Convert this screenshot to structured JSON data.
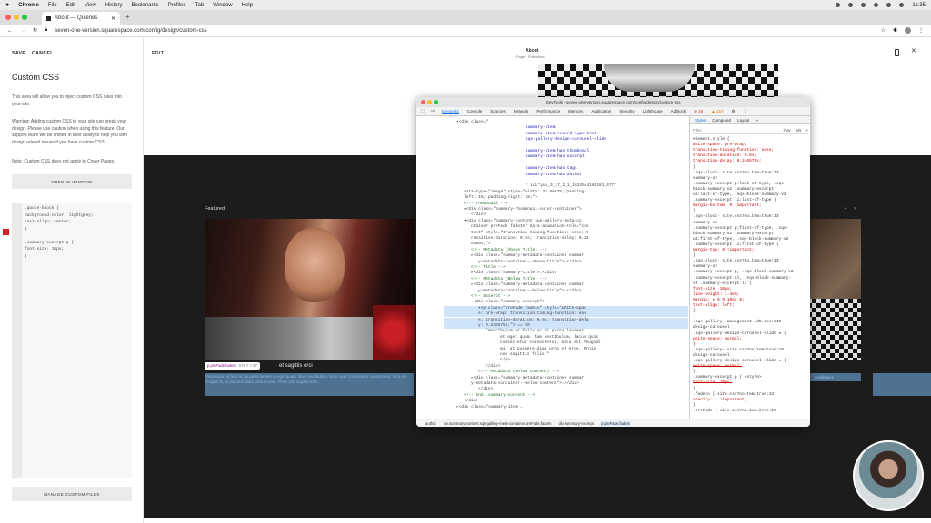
{
  "menubar": {
    "app": "Chrome",
    "items": [
      "File",
      "Edit",
      "View",
      "History",
      "Bookmarks",
      "Profiles",
      "Tab",
      "Window",
      "Help"
    ],
    "clock": "11:35"
  },
  "browser": {
    "tab_title": "About — Quienes",
    "url": "seven-one-version.squarespace.com/config/design/custom-css"
  },
  "left_panel": {
    "save": "SAVE",
    "cancel": "CANCEL",
    "title": "Custom CSS",
    "intro": "This area will allow you to inject custom CSS rules into your site.",
    "warning": "Warning: Adding custom CSS to your site can break your design. Please use caution when using this feature. Our support team will be limited in their ability to help you with design related issues if you have custom CSS.",
    "note": "Note: Custom CSS does not apply to Cover Pages.",
    "open_window": "OPEN IN WINDOW",
    "manage_files": "MANAGE CUSTOM FILES",
    "code": [
      ".quote-block {",
      "  background-color: lightgrey;",
      "  text-align: center;",
      "}",
      "",
      ".summary-excerpt p {",
      "  font-size: 10px;",
      "}"
    ]
  },
  "preview": {
    "edit": "EDIT",
    "page_title": "About",
    "page_status": "Page · Published",
    "featured": "Featured",
    "element_tag": "p.preFade.fadeIn",
    "element_size": "578.7 × 57",
    "caption_heading": "et sagittis orci",
    "excerpt": "Vestibulum ut felis ac mi porta laoreet et eget quam. Nam vestibulum, lacus quis consectetur consectetur, arcu est feugiat mi, at posuere diam urna et eros. Proin non sagittis felis.",
    "right_caption": "vestibulum"
  },
  "devtools": {
    "title": "DevTools - seven-one-version.squarespace.com/config/design/custom-css",
    "tabs": [
      "Elements",
      "Console",
      "Sources",
      "Network",
      "Performance",
      "Memory",
      "Application",
      "Security",
      "Lighthouse",
      "AdBlock"
    ],
    "errors": "25",
    "warnings": "157",
    "style_tabs": [
      "Styles",
      "Computed",
      "Layout",
      "»"
    ],
    "filter": "Filter",
    "filter_tags": [
      ":hov",
      ".cls",
      "+"
    ],
    "dom_lines": [
      "▾<div class=\"",
      "summary-item",
      "summary-item-record-type-text",
      "sqs-gallery-design-carousel-slide",
      "",
      "summary-item-has-thumbnail",
      "summary-item-has-excerpt",
      "",
      "summary-item-has-tags",
      "summary-item-has-author",
      "",
      "\" id=\"yui_3_17_2_1_1624544189181_477\"",
      "data-type=\"image\" style=\"width: 33.6667%; padding-",
      "left: 1%; padding-right: 1%;\">",
      "<!-- Thumbnail -->",
      "▸<div class=\"summary-thumbnail-outer-container\">",
      "</div>",
      "▾<div class=\"summary-content sqs-gallery-meta-co",
      "ntainer preFade fadeIn\" data-animation-role=\"con",
      "tent\" style=\"transition-timing-function: ease; t",
      "ransition-duration: 0.6s; transition-delay: 0.23",
      "8366s;\">",
      "<!-- Metadata (Above Title) -->",
      "▸<div class=\"summary-metadata-container summar",
      "y-metadata-container--above-title\">…</div>",
      "<!-- Title -->",
      "▸<div class=\"summary-title\">…</div>",
      "<!-- Metadata (Below Title) -->",
      "▸<div class=\"summary-metadata-container summar",
      "y-metadata-container--below-title\">…</div>",
      "<!-- Excerpt -->",
      "▾<div class=\"summary-excerpt\">",
      "▾<p class=\"preFade fadeIn\" style=\"white-spac",
      "e: pre-wrap; transition-timing-function: eas",
      "e; transition-duration: 0.6s; transition-dela",
      "y: 0.246575s;\"> == $0",
      "\"Vestibulum ut felis ac mi porta laoreet",
      "et eget quam. Nam vestibulum, lacus quis",
      "consectetur consectetur, arcu est feugiat",
      "mi, at posuere diam urna et eros. Proin",
      "non sagittis felis.\"",
      "</p>",
      "</div>",
      "<!-- Metadata (Below Content) -->",
      "▸<div class=\"summary-metadata-container summar",
      "y-metadata-container--below-content\">…</div>",
      "</div>",
      "<!-- End .summary-content -->",
      "</div>",
      "▸<div class=\"summary-item …"
    ],
    "style_lines": [
      "element.style {",
      "  white-space: pre-wrap;",
      "  transition-timing-function: ease;",
      "  transition-duration: 0.6s;",
      "  transition-delay: 0.246575s;",
      "}",
      ".sqs-block-    site.css?no…tem=true:13",
      "summary-v2",
      ".summary-excerpt p:last-of-type, .sqs-",
      "block-summary-v2 .summary-excerpt",
      "ul:last-of-type, .sqs-block-summary-v2",
      ".summary-excerpt li:last-of-type {",
      "  margin-bottom: 0 !important;",
      "}",
      ".sqs-block-    site.css?no…tem=true:13",
      "summary-v2",
      ".summary-excerpt p:first-of-type, .sqs-",
      "block-summary-v2 .summary-excerpt",
      "ul:first-of-type, .sqs-block-summary-v2",
      ".summary-excerpt li:first-of-type {",
      "  margin-top: 0 !important;",
      "}",
      ".sqs-block-    site.css?no…tem=true:13",
      "summary-v2",
      ".summary-excerpt p, .sqs-block-summary-v2",
      ".summary-excerpt ul, .sqs-block-summary-",
      "v2 .summary-excerpt li {",
      "  font-size: 10px;",
      "  line-height: 1.4em;",
      "  margin: ▸ 0 0 10px 0;",
      "  text-align: left;",
      "}",
      "",
      ".sqs-gallery-   management-…d5.css:349",
      "design-carousel",
      ".sqs-gallery-design-carousel-slide ★ {",
      "  white-space: normal;",
      "}",
      ".sqs-gallery-   site.css?no…tem=true:10",
      "design-carousel",
      ".sqs-gallery-design-carousel-slide ★ {",
      "  white-space: normal;",
      "}",
      ".summary-excerpt p {         <style>",
      "  font-size: 10px;",
      "}",
      ".fadeIn {      site.css?no…tem=true:13",
      "  opacity: 1 !important;",
      "}",
      ".preFade {     site.css?no…tem=true:13"
    ],
    "breadcrumbs": [
      "author",
      "div.summary-content.sqs-gallery-meta-container.preFade.fadeIn",
      "div.summary-excerpt",
      "p.preFade.fadeIn"
    ]
  },
  "colors": {
    "accent": "#1a73e8",
    "highlight": "#cfe3fa",
    "dark_bg": "#1c1c1c"
  }
}
